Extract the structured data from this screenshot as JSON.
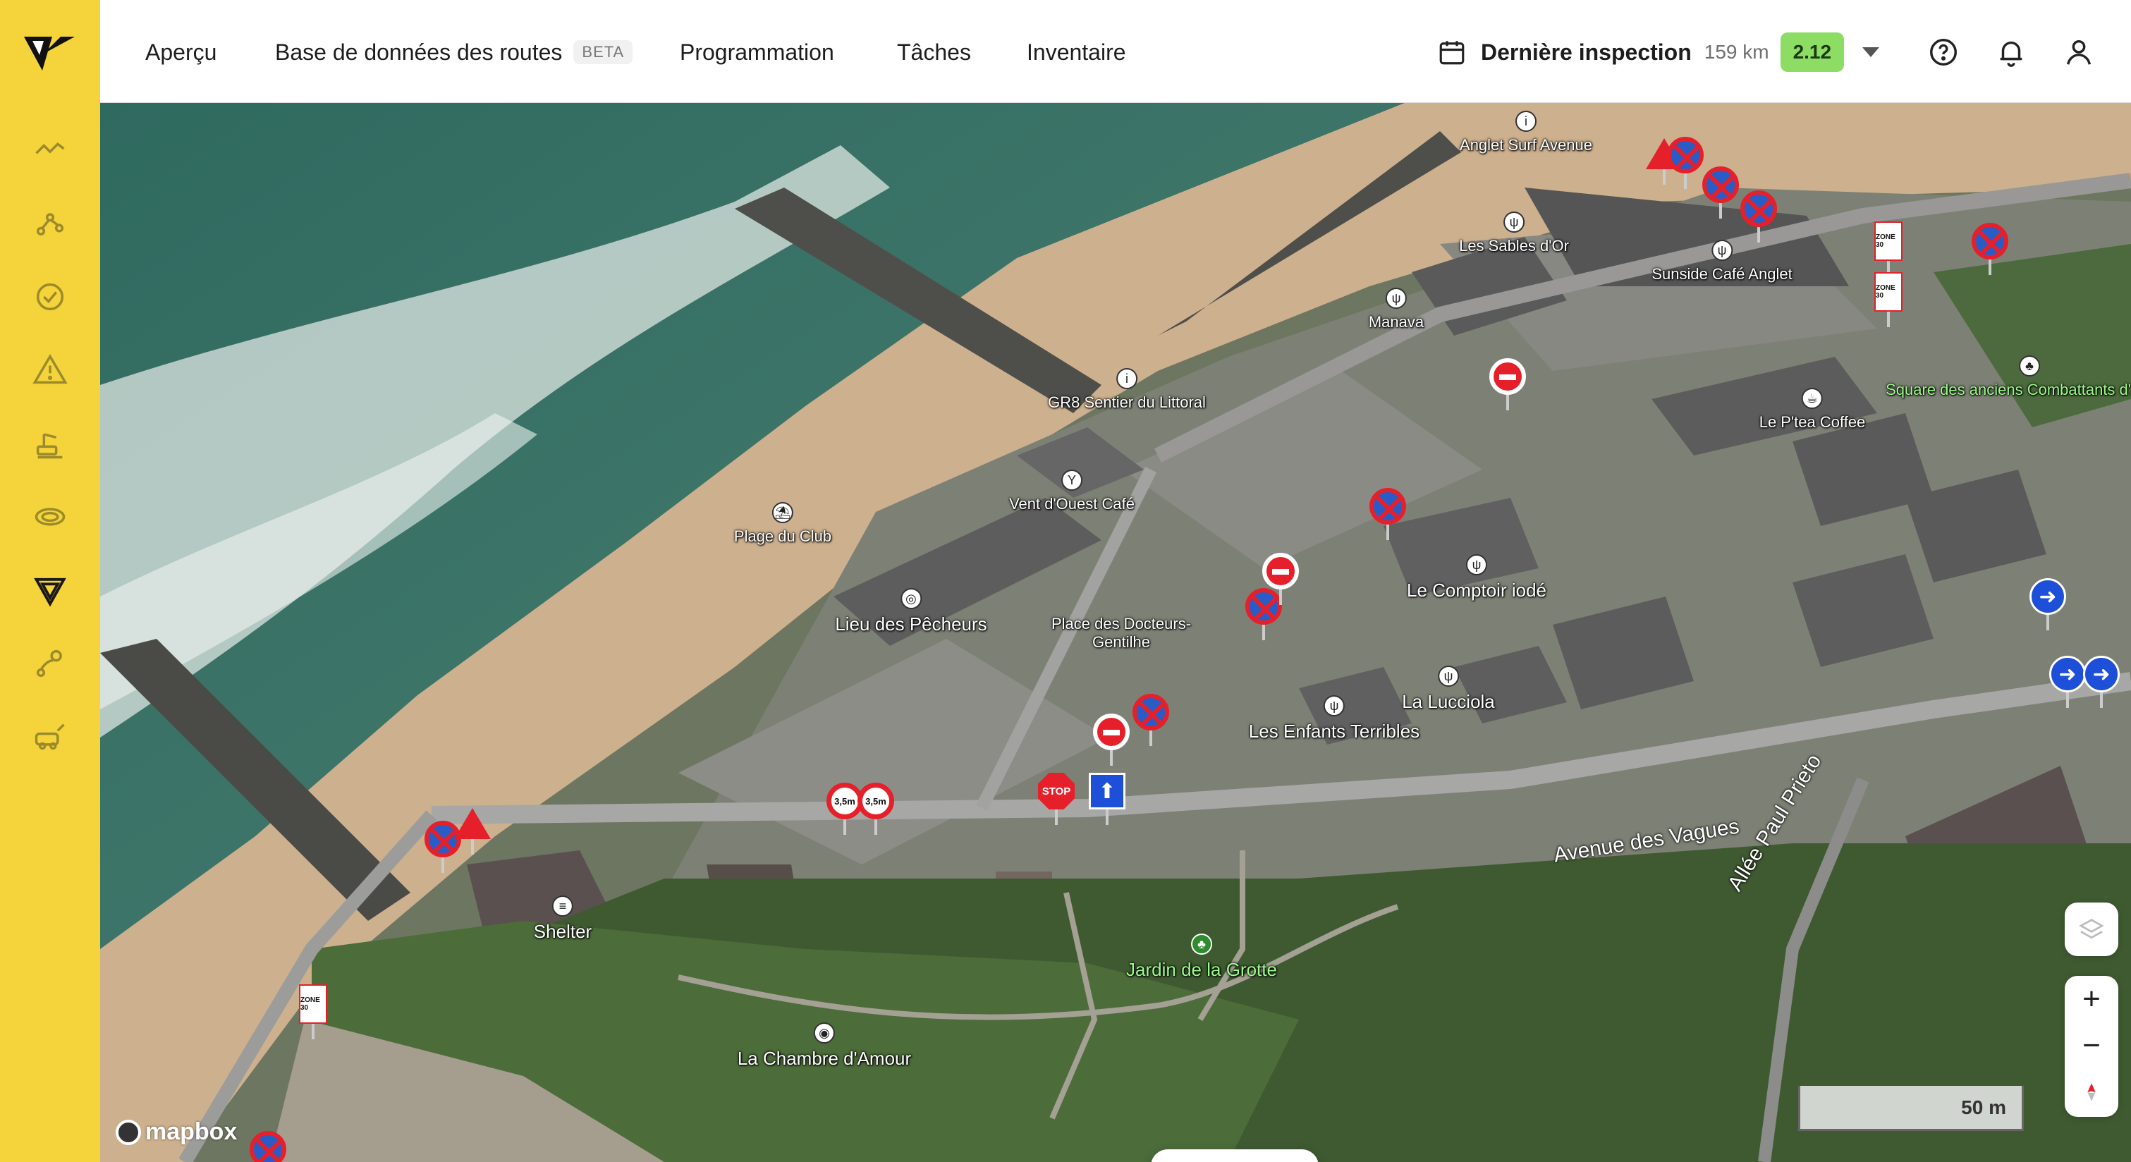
{
  "app": {
    "name": "Vialytics"
  },
  "sidebar": {
    "items": [
      {
        "name": "overview",
        "icon": "line-chart-icon"
      },
      {
        "name": "routes",
        "icon": "route-nodes-icon"
      },
      {
        "name": "tasks",
        "icon": "check-circle-icon"
      },
      {
        "name": "alerts",
        "icon": "warning-triangle-icon"
      },
      {
        "name": "road-work",
        "icon": "excavator-icon"
      },
      {
        "name": "surface",
        "icon": "disc-icon"
      },
      {
        "name": "signs",
        "icon": "sign-triangle-icon",
        "active": true
      },
      {
        "name": "network",
        "icon": "map-marker-route-icon"
      },
      {
        "name": "vehicles",
        "icon": "vehicle-icon"
      }
    ]
  },
  "topnav": {
    "items": [
      {
        "label": "Aperçu"
      },
      {
        "label": "Base de données des routes",
        "badge": "BETA"
      },
      {
        "label": "Programmation"
      },
      {
        "label": "Tâches"
      },
      {
        "label": "Inventaire"
      }
    ]
  },
  "inspection": {
    "label": "Dernière inspection",
    "distance": "159 km",
    "version": "2.12",
    "badge_color": "#8ddd65"
  },
  "map": {
    "pois": [
      {
        "label": "Anglet Surf Avenue",
        "glyph": "i"
      },
      {
        "label": "Les Sables d'Or",
        "glyph": "ψ"
      },
      {
        "label": "Sunside Café Anglet",
        "glyph": "ψ"
      },
      {
        "label": "Manava",
        "glyph": "ψ"
      },
      {
        "label": "GR8 Sentier du Littoral",
        "glyph": "i"
      },
      {
        "label": "Square des anciens Combattants d'A.F.N.",
        "glyph": "♣"
      },
      {
        "label": "Le P'tea Coffee",
        "glyph": "☕"
      },
      {
        "label": "Plage du Club",
        "glyph": "⛱"
      },
      {
        "label": "Vent d'Ouest Café",
        "glyph": "Y"
      },
      {
        "label": "Lieu des Pêcheurs",
        "glyph": "◎"
      },
      {
        "label": "Place des Docteurs-Gentilhe",
        "glyph": ""
      },
      {
        "label": "Le Comptoir iodé",
        "glyph": "ψ"
      },
      {
        "label": "La Lucciola",
        "glyph": "ψ"
      },
      {
        "label": "Les Enfants Terribles",
        "glyph": "ψ"
      },
      {
        "label": "Shelter",
        "glyph": "≡"
      },
      {
        "label": "Jardin de la Grotte",
        "glyph": "♣"
      },
      {
        "label": "La Chambre d'Amour",
        "glyph": "◉"
      }
    ],
    "roads": [
      {
        "label": "Avenue des Vagues"
      },
      {
        "label": "Allée Paul Prieto"
      }
    ],
    "sign_texts": {
      "stop": "STOP",
      "height": "3,5m",
      "zone": "ZONE 30"
    },
    "scale_label": "50 m",
    "attribution": "mapbox"
  },
  "colors": {
    "sidebar": "#f5d33b",
    "sign_red": "#e5202a",
    "sign_blue": "#2a5cc8",
    "badge": "#8ddd65"
  }
}
